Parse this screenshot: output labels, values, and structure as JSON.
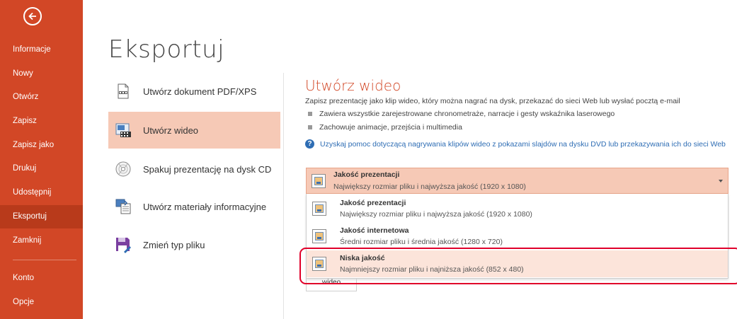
{
  "sidebar": {
    "back_icon": "arrow-left-circle-icon",
    "items": [
      {
        "label": "Informacje"
      },
      {
        "label": "Nowy"
      },
      {
        "label": "Otwórz"
      },
      {
        "label": "Zapisz"
      },
      {
        "label": "Zapisz jako"
      },
      {
        "label": "Drukuj"
      },
      {
        "label": "Udostępnij"
      },
      {
        "label": "Eksportuj",
        "active": true
      },
      {
        "label": "Zamknij"
      },
      {
        "label": "Konto"
      },
      {
        "label": "Opcje"
      }
    ],
    "colors": {
      "background": "#D24726",
      "active": "#B83A1B"
    }
  },
  "page": {
    "title": "Eksportuj"
  },
  "export_options": [
    {
      "label": "Utwórz dokument PDF/XPS",
      "icon": "pdf-document-icon"
    },
    {
      "label": "Utwórz wideo",
      "icon": "video-icon",
      "selected": true
    },
    {
      "label": "Spakuj prezentację na dysk CD",
      "icon": "cd-icon"
    },
    {
      "label": "Utwórz materiały informacyjne",
      "icon": "handouts-icon"
    },
    {
      "label": "Zmień typ pliku",
      "icon": "save-file-type-icon"
    }
  ],
  "video": {
    "title": "Utwórz wideo",
    "description": "Zapisz prezentację jako klip wideo, który można nagrać na dysk, przekazać do sieci Web lub wysłać pocztą e-mail",
    "bullets": [
      "Zawiera wszystkie zarejestrowane chronometraże, narracje i gesty wskaźnika laserowego",
      "Zachowuje animacje, przejścia i multimedia"
    ],
    "help_link": "Uzyskaj pomoc dotyczącą nagrywania klipów wideo z pokazami slajdów na dysku DVD lub przekazywania ich do sieci Web",
    "quality_selected": {
      "title": "Jakość prezentacji",
      "subtitle": "Największy rozmiar pliku i najwyższa jakość (1920 x 1080)"
    },
    "quality_options": [
      {
        "title": "Jakość prezentacji",
        "subtitle": "Największy rozmiar pliku i najwyższa jakość (1920 x 1080)"
      },
      {
        "title": "Jakość internetowa",
        "subtitle": "Średni rozmiar pliku i średnia jakość (1280 x 720)"
      },
      {
        "title": "Niska jakość",
        "subtitle": "Najmniejszy rozmiar pliku i najniższa jakość (852 x 480)",
        "highlighted": true
      }
    ],
    "create_button_fragment": "wideo"
  },
  "colors": {
    "accent": "#D24726",
    "selected_bg": "#F6C9B6",
    "link": "#2E6DB4",
    "annotation": "#E0002A"
  }
}
